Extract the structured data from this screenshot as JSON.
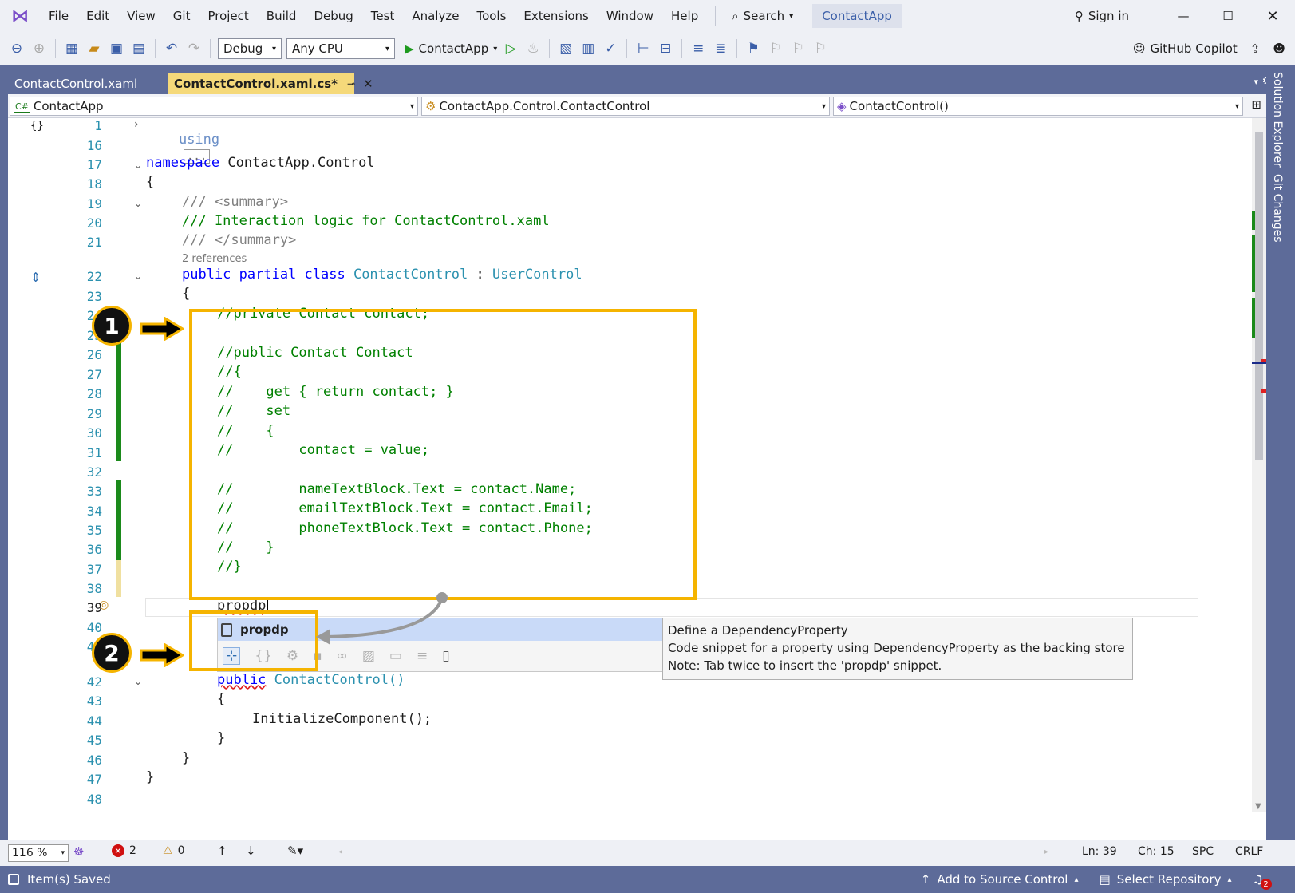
{
  "menu": [
    "File",
    "Edit",
    "View",
    "Git",
    "Project",
    "Build",
    "Debug",
    "Test",
    "Analyze",
    "Tools",
    "Extensions",
    "Window",
    "Help"
  ],
  "search_label": "Search",
  "solution_name": "ContactApp",
  "sign_in": "Sign in",
  "toolbar": {
    "config": "Debug",
    "platform": "Any CPU",
    "run_target": "ContactApp",
    "copilot": "GitHub Copilot"
  },
  "tabs": [
    {
      "label": "ContactControl.xaml"
    },
    {
      "label": "ContactControl.xaml.cs*"
    }
  ],
  "nav": {
    "project": "ContactApp",
    "type": "ContactApp.Control.ContactControl",
    "member": "ContactControl()"
  },
  "side_tabs": [
    "Solution Explorer",
    "Git Changes"
  ],
  "code": {
    "l1_kw": "using",
    "l1_box": "...",
    "ns_kw": "namespace",
    "ns_name": "ContactApp.Control",
    "sum_open": "/// <summary>",
    "sum_text": "/// Interaction logic for ContactControl.xaml",
    "sum_close": "/// </summary>",
    "refs": "2 references",
    "cls_kw": "public partial class",
    "cls_name": "ContactControl",
    "cls_colon": ":",
    "cls_base": "UserControl",
    "c24": "//private Contact contact;",
    "c26": "//public Contact Contact",
    "c27": "//{",
    "c28": "//    get { return contact; }",
    "c29": "//    set",
    "c30": "//    {",
    "c31": "//        contact = value;",
    "c33": "//        nameTextBlock.Text = contact.Name;",
    "c34": "//        emailTextBlock.Text = contact.Email;",
    "c35": "//        phoneTextBlock.Text = contact.Phone;",
    "c36": "//    }",
    "c37": "//}",
    "typed": "propdp",
    "ctor_kw": "public",
    "ctor_name": "ContactControl()",
    "init": "InitializeComponent();"
  },
  "lines": [
    "1",
    "16",
    "17",
    "18",
    "19",
    "20",
    "21",
    "22",
    "23",
    "24",
    "25",
    "26",
    "27",
    "28",
    "29",
    "30",
    "31",
    "32",
    "33",
    "34",
    "35",
    "36",
    "37",
    "38",
    "39",
    "40",
    "41",
    "42",
    "43",
    "44",
    "45",
    "46",
    "47",
    "48"
  ],
  "completion": {
    "item": "propdp",
    "tip_title": "Define a DependencyProperty",
    "tip_line1": "Code snippet for a property using DependencyProperty as the backing store",
    "tip_line2": "Note: Tab twice to insert the 'propdp' snippet."
  },
  "badges": [
    "1",
    "2"
  ],
  "status": {
    "zoom": "116 %",
    "errors": "2",
    "warnings": "0",
    "ln": "Ln: 39",
    "ch": "Ch: 15",
    "spc": "SPC",
    "crlf": "CRLF"
  },
  "bottom": {
    "saved": "Item(s) Saved",
    "source_control": "Add to Source Control",
    "repo": "Select Repository",
    "notif": "2"
  },
  "colors": {
    "accent": "#f5b400",
    "chrome": "#5d6b99",
    "keyword": "#0000ff",
    "type": "#2b91af",
    "comment": "#008000"
  }
}
